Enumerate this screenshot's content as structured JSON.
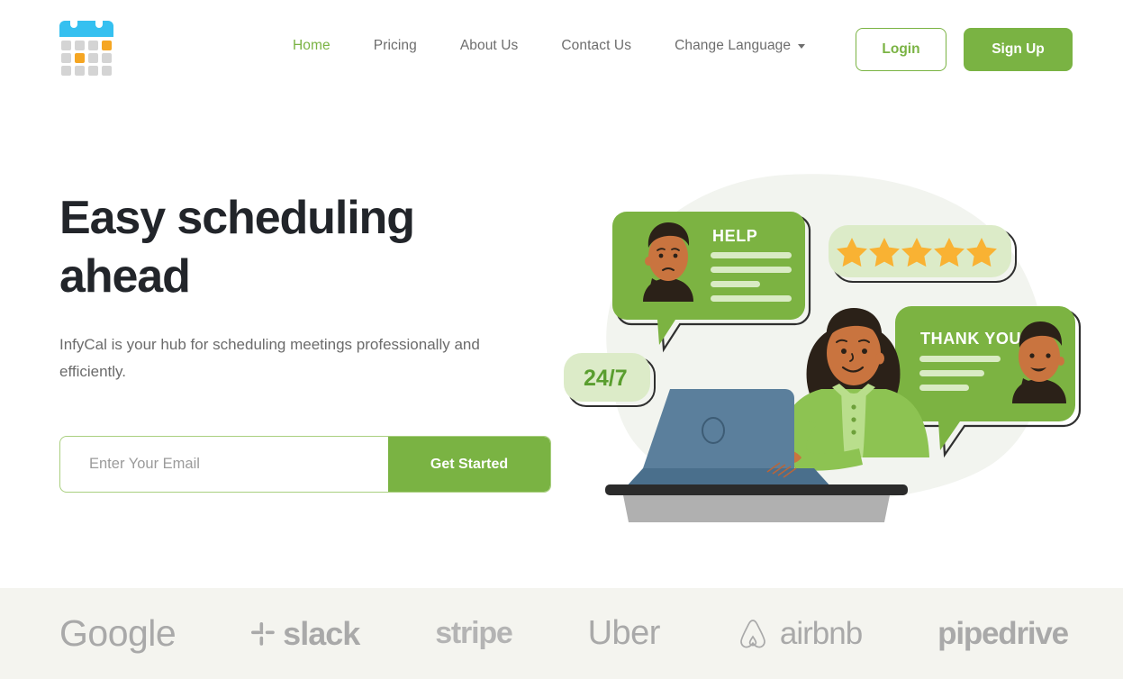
{
  "brand": {
    "logo_icon": "calendar-icon",
    "name": "InfyCal"
  },
  "colors": {
    "accent_green": "#7ab343",
    "accent_green_light": "#a9cf7f",
    "bubble_green": "#7cb342",
    "badge_green_bg": "#dcebc8",
    "star_orange": "#f9b233",
    "logo_blue": "#35c0f0",
    "logo_orange": "#f5a623",
    "logo_gray": "#d4d4d4",
    "headline_dark": "#22252a",
    "body_gray": "#6b6b6b",
    "strip_bg": "#f4f4ef",
    "brand_gray": "#a9a9a9"
  },
  "nav": {
    "items": [
      {
        "label": "Home",
        "active": true
      },
      {
        "label": "Pricing",
        "active": false
      },
      {
        "label": "About Us",
        "active": false
      },
      {
        "label": "Contact Us",
        "active": false
      }
    ],
    "language_label": "Change Language",
    "language_caret_icon": "chevron-down-icon",
    "login_label": "Login",
    "signup_label": "Sign Up"
  },
  "hero": {
    "headline": "Easy scheduling ahead",
    "subhead": "InfyCal is your hub for scheduling meetings professionally and efficiently.",
    "email_placeholder": "Enter Your Email",
    "email_value": "",
    "cta_label": "Get Started",
    "illustration": {
      "help_bubble_label": "HELP",
      "thankyou_bubble_label": "THANK YOU",
      "availability_badge": "24/7",
      "star_rating": 5
    }
  },
  "logo_strip": {
    "brands": [
      {
        "name": "Google"
      },
      {
        "name": "slack"
      },
      {
        "name": "stripe"
      },
      {
        "name": "Uber"
      },
      {
        "name": "airbnb"
      },
      {
        "name": "pipedrive"
      }
    ]
  }
}
